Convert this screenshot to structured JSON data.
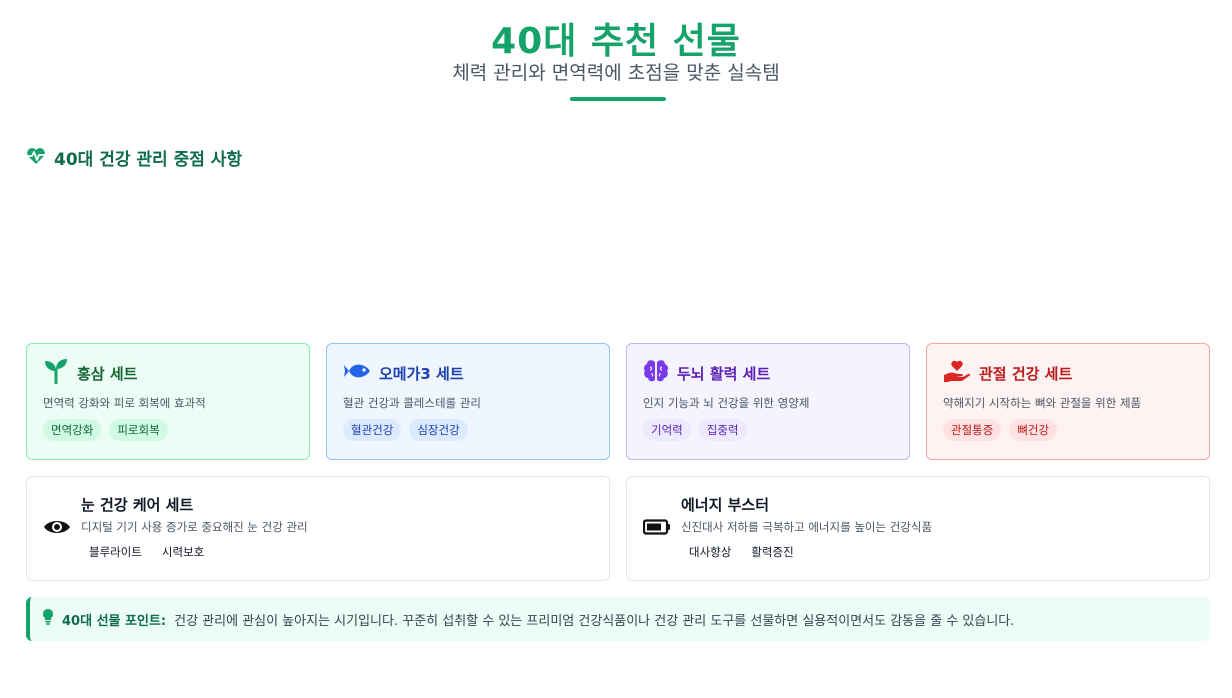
{
  "header": {
    "title": "40대 추천 선물",
    "subtitle": "체력 관리와 면역력에 초점을 맞춘 실속템"
  },
  "section": {
    "title": "40대 건강 관리 중점 사항",
    "icon": "heartbeat-icon"
  },
  "cards": [
    {
      "title": "홍삼 세트",
      "icon": "sprout-icon",
      "desc": "면역력 강화와 피로 회복에 효과적",
      "tags": [
        "면역강화",
        "피로회복"
      ]
    },
    {
      "title": "오메가3 세트",
      "icon": "fish-icon",
      "desc": "혈관 건강과 콜레스테롤 관리",
      "tags": [
        "혈관건강",
        "심장건강"
      ]
    },
    {
      "title": "두뇌 활력 세트",
      "icon": "brain-icon",
      "desc": "인지 기능과 뇌 건강을 위한 영양제",
      "tags": [
        "기억력",
        "집중력"
      ]
    },
    {
      "title": "관절 건강 세트",
      "icon": "hand-holding-heart-icon",
      "desc": "약해지기 시작하는 뼈와 관절을 위한 제품",
      "tags": [
        "관절통증",
        "뼈건강"
      ]
    }
  ],
  "wide_cards": [
    {
      "title": "눈 건강 케어 세트",
      "icon": "eye-icon",
      "desc": "디지털 기기 사용 증가로 중요해진 눈 건강 관리",
      "tags": [
        "블루라이트",
        "시력보호"
      ]
    },
    {
      "title": "에너지 부스터",
      "icon": "battery-icon",
      "desc": "신진대사 저하를 극복하고 에너지를 높이는 건강식품",
      "tags": [
        "대사향상",
        "활력증진"
      ]
    }
  ],
  "tip": {
    "label": "40대 선물 포인트:",
    "text": "건강 관리에 관심이 높아지는 시기입니다. 꾸준히 섭취할 수 있는 프리미엄 건강식품이나 건강 관리 도구를 선물하면 실용적이면서도 감동을 줄 수 있습니다.",
    "icon": "lightbulb-icon"
  },
  "colors": {
    "accent": "#16a36b",
    "green": "#166534",
    "blue": "#1e40af",
    "purple": "#5b21b6",
    "red": "#b91c1c"
  }
}
